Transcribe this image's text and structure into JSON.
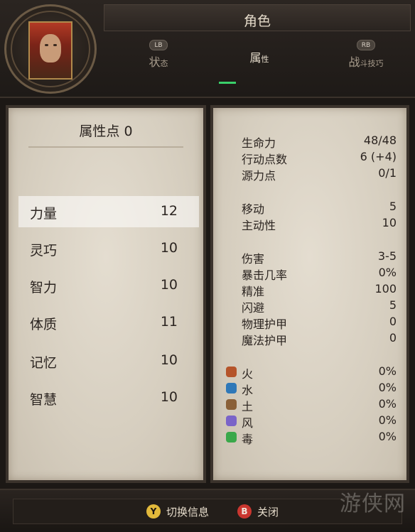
{
  "header": {
    "title": "角色",
    "tabs": [
      {
        "button": "LB",
        "label": "状",
        "label_small": "态"
      },
      {
        "button": "",
        "label": "属",
        "label_small": "性"
      },
      {
        "button": "RB",
        "label": "战",
        "label_small": "斗技巧"
      }
    ]
  },
  "attributes": {
    "points_label": "属性点 0",
    "rows": [
      {
        "name": "力量",
        "value": "12"
      },
      {
        "name": "灵巧",
        "value": "10"
      },
      {
        "name": "智力",
        "value": "10"
      },
      {
        "name": "体质",
        "value": "11"
      },
      {
        "name": "记忆",
        "value": "10"
      },
      {
        "name": "智慧",
        "value": "10"
      }
    ]
  },
  "stats": {
    "vitals": [
      {
        "name": "生命力",
        "value": "48/48"
      },
      {
        "name": "行动点数",
        "value": "6 (+4)"
      },
      {
        "name": "源力点",
        "value": "0/1"
      }
    ],
    "movement": [
      {
        "name": "移动",
        "value": "5"
      },
      {
        "name": "主动性",
        "value": "10"
      }
    ],
    "combat": [
      {
        "name": "伤害",
        "value": "3-5"
      },
      {
        "name": "暴击几率",
        "value": "0%"
      },
      {
        "name": "精准",
        "value": "100"
      },
      {
        "name": "闪避",
        "value": "5"
      },
      {
        "name": "物理护甲",
        "value": "0"
      },
      {
        "name": "魔法护甲",
        "value": "0"
      }
    ],
    "resistances": [
      {
        "name": "火",
        "value": "0%",
        "icon": "fire-icon",
        "color": "#b5542a"
      },
      {
        "name": "水",
        "value": "0%",
        "icon": "water-icon",
        "color": "#2f78b8"
      },
      {
        "name": "土",
        "value": "0%",
        "icon": "earth-icon",
        "color": "#8a6038"
      },
      {
        "name": "风",
        "value": "0%",
        "icon": "air-icon",
        "color": "#7a64c8"
      },
      {
        "name": "毒",
        "value": "0%",
        "icon": "poison-icon",
        "color": "#3aa84a"
      }
    ]
  },
  "footer": {
    "switch_button": "Y",
    "switch_label": "切换信息",
    "close_button": "B",
    "close_label": "关闭"
  },
  "watermark": "游侠网"
}
